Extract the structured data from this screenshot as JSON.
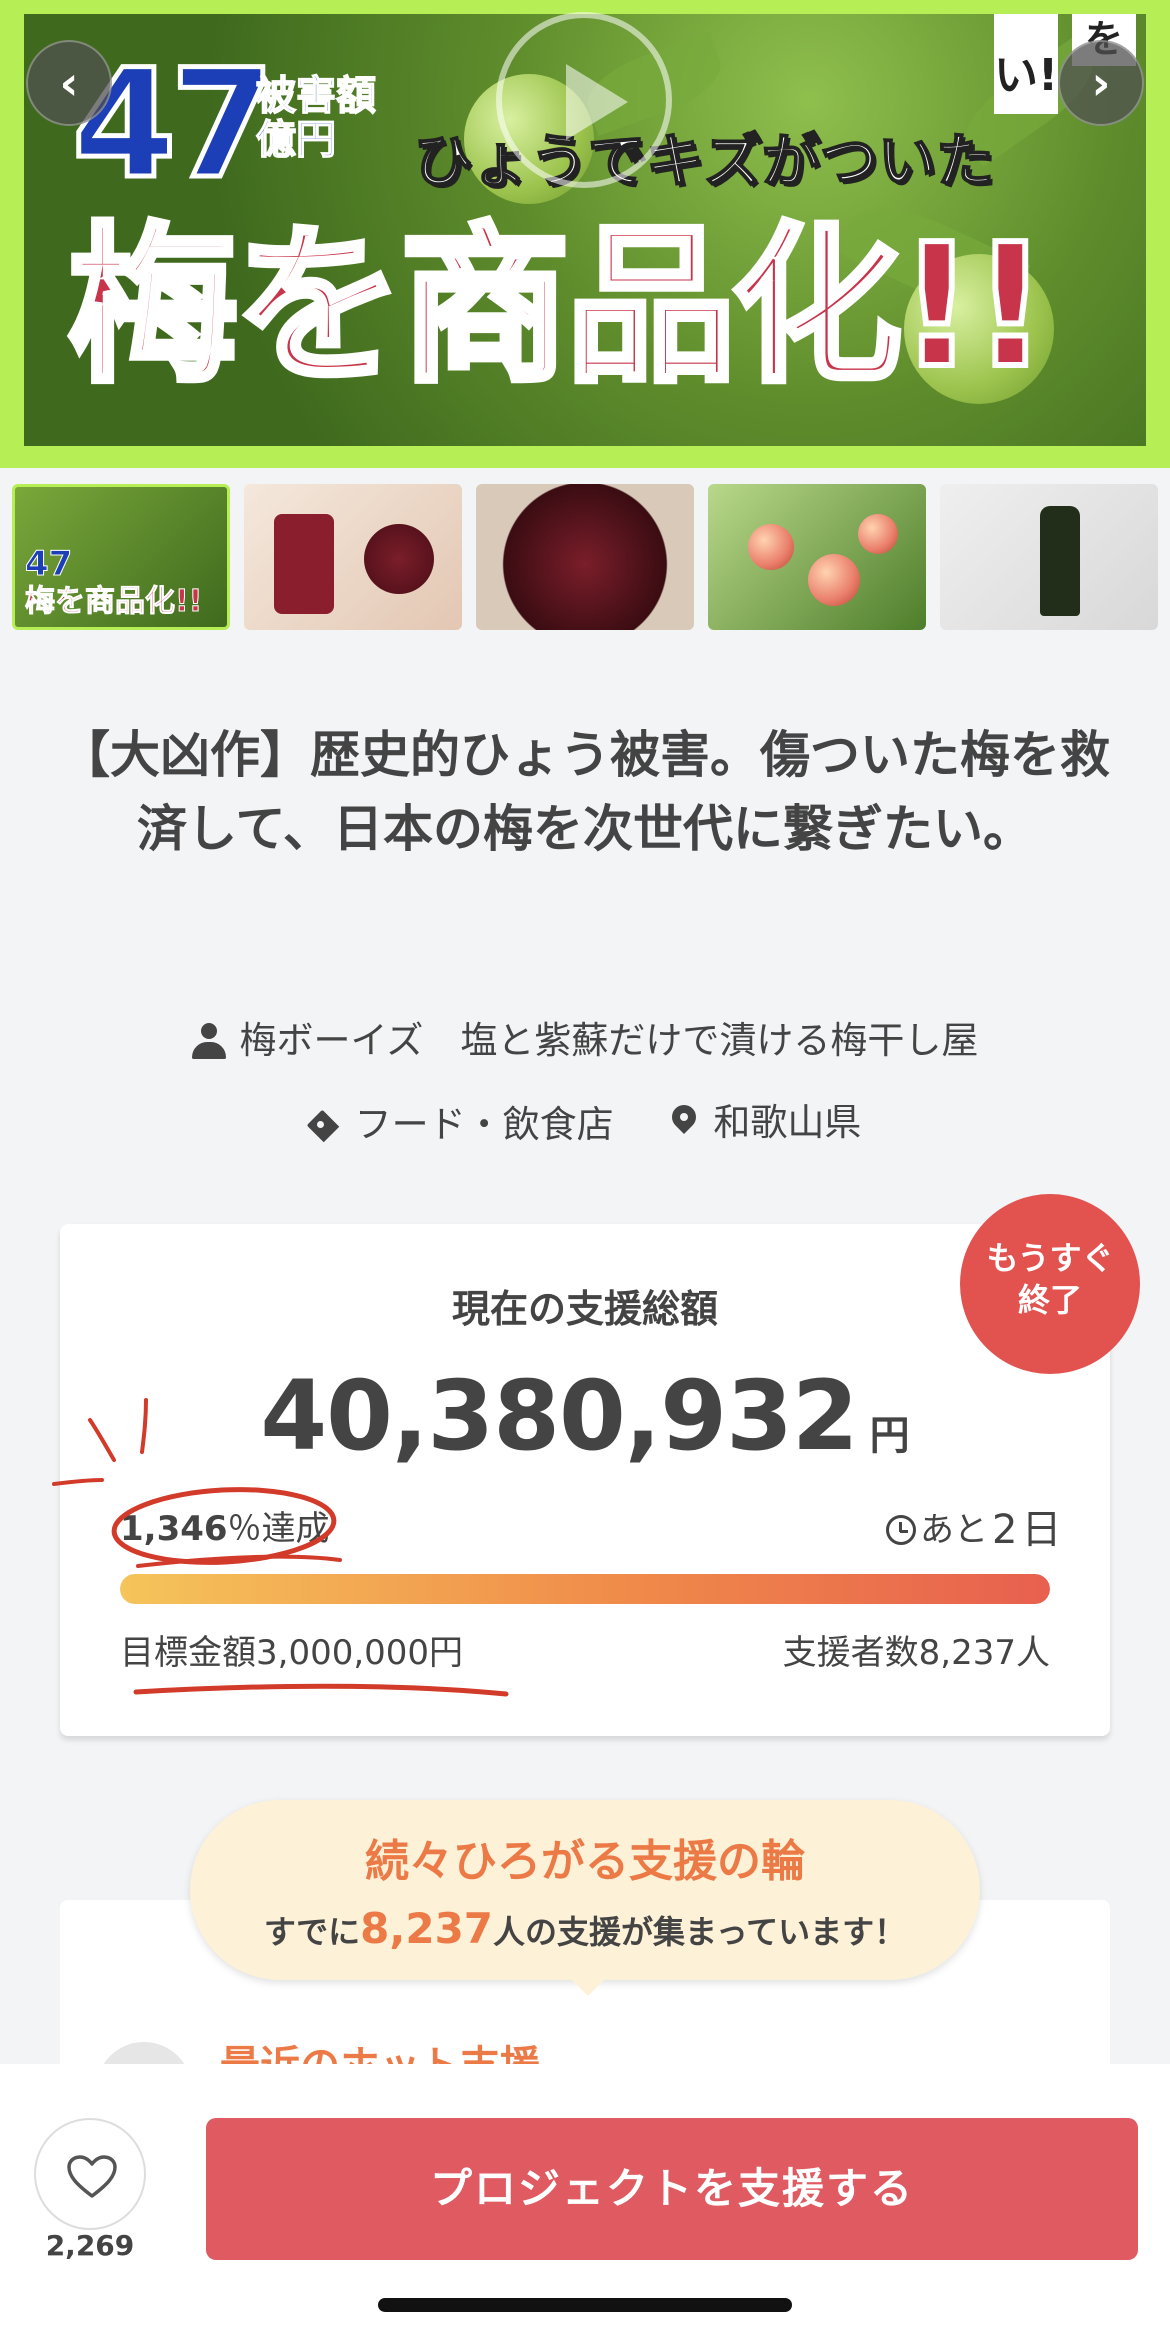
{
  "hero": {
    "damage_number": "47",
    "damage_label": "被害額億円",
    "subtitle": "ひょうでキズがついた",
    "main_text": "梅を商品化!!",
    "tag_1": "い!",
    "tag_2": "を",
    "prev_label": "‹",
    "next_label": "›"
  },
  "thumbnails": {
    "thumb_1_number": "47",
    "thumb_1_text": "梅を商品化!!"
  },
  "project": {
    "title": "【大凶作】歴史的ひょう被害。傷ついた梅を救済して、日本の梅を次世代に繋ぎたい。",
    "owner": "梅ボーイズ　塩と紫蘇だけで漬ける梅干し屋",
    "category": "フード・飲食店",
    "location": "和歌山県"
  },
  "funding": {
    "label": "現在の支援総額",
    "amount": "40,380,932",
    "currency": "円",
    "achievement_number": "1,346",
    "achievement_suffix": "％達成",
    "remaining_prefix": "あと",
    "remaining_days": "2",
    "remaining_suffix": "日",
    "progress_percent": 100,
    "goal": "目標金額3,000,000円",
    "backers": "支援者数8,237人",
    "ending_badge": "もうすぐ\n終了"
  },
  "support": {
    "title": "続々ひろがる支援の輪",
    "text_prefix": "すでに",
    "count": "8,237",
    "text_suffix": "人の支援が集まっています！",
    "recent_label": "最近のホット支援"
  },
  "bottom_bar": {
    "like_count": "2,269",
    "support_button": "プロジェクトを支援する"
  },
  "colors": {
    "accent_red": "#e05a62",
    "badge_red": "#e2524f",
    "orange": "#ec7a46",
    "hero_border": "#b6ee55"
  }
}
